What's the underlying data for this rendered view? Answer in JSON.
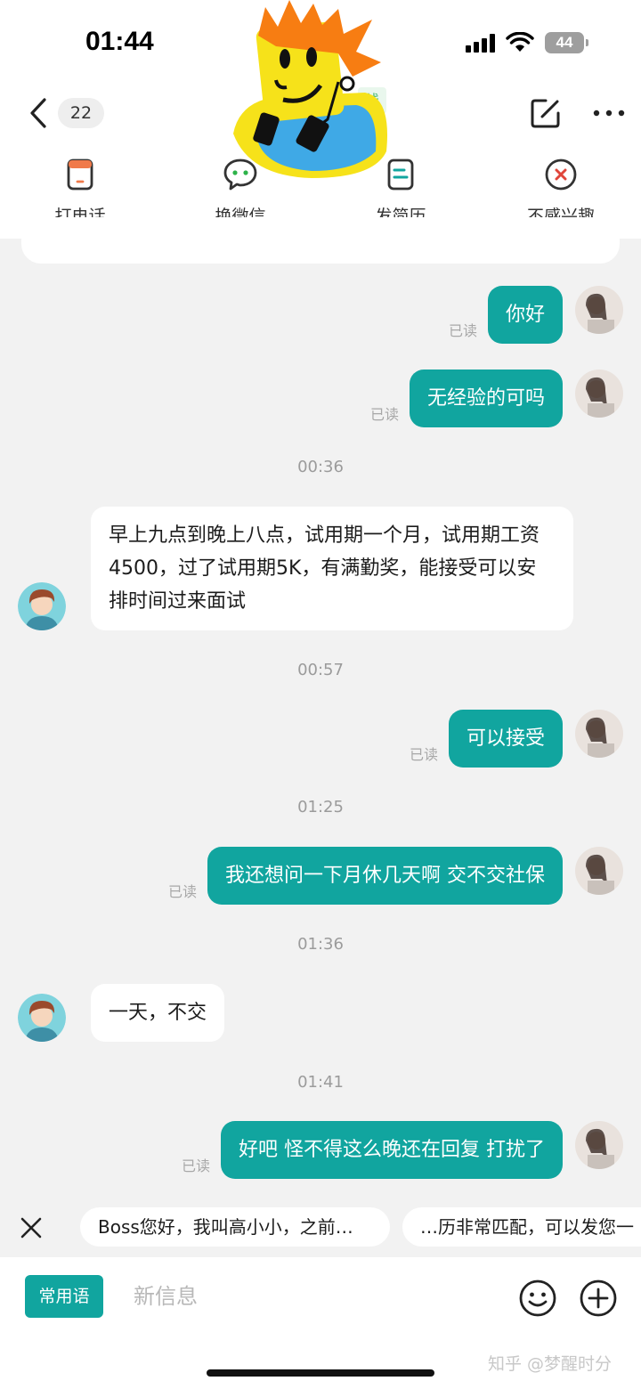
{
  "status": {
    "time": "01:44",
    "battery": "44"
  },
  "header": {
    "unread_count": "22",
    "online_tag": "线"
  },
  "actions": [
    {
      "label": "打电话",
      "icon": "phone-card-icon"
    },
    {
      "label": "换微信",
      "icon": "wechat-bubble-icon"
    },
    {
      "label": "发简历",
      "icon": "resume-icon"
    },
    {
      "label": "不感兴趣",
      "icon": "not-interested-icon"
    }
  ],
  "colors": {
    "accent": "#11a59f",
    "background": "#f2f2f2"
  },
  "chat": {
    "read_label": "已读",
    "messages": {
      "m1": "你好",
      "m2": "无经验的可吗",
      "t1": "00:36",
      "m3": "早上九点到晚上八点，试用期一个月，试用期工资4500，过了试用期5K，有满勤奖，能接受可以安排时间过来面试",
      "t2": "00:57",
      "m4": "可以接受",
      "t3": "01:25",
      "m5": "我还想问一下月休几天啊 交不交社保",
      "t4": "01:36",
      "m6": "一天，不交",
      "t5": "01:41",
      "m7": "好吧 怪不得这么晚还在回复 打扰了"
    }
  },
  "quick_replies": [
    "Boss您好，我叫高小小，之前…",
    "…历非常匹配，可以发您一"
  ],
  "input": {
    "phrase_label": "常用语",
    "placeholder": "新信息"
  },
  "watermark": "知乎 @梦醒时分"
}
